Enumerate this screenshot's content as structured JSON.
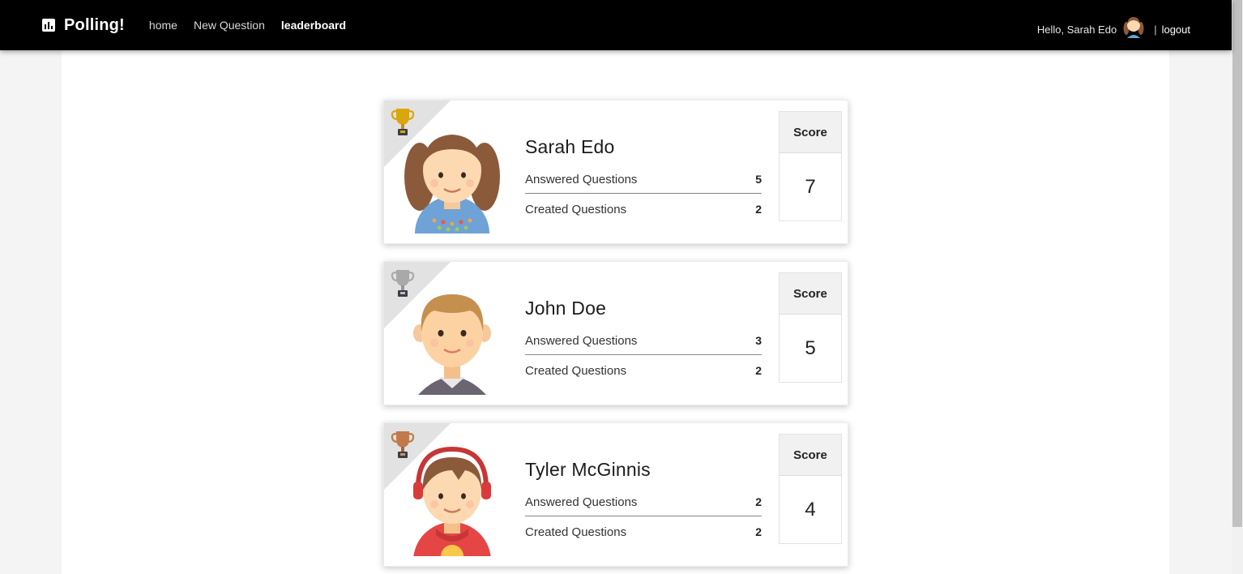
{
  "navbar": {
    "brand": "Polling!",
    "links": [
      {
        "label": "home",
        "active": false
      },
      {
        "label": "New Question",
        "active": false
      },
      {
        "label": "leaderboard",
        "active": true
      }
    ],
    "greeting": "Hello, Sarah Edo",
    "separator": "|",
    "logout_label": "logout"
  },
  "leaderboard": {
    "answered_label": "Answered Questions",
    "created_label": "Created Questions",
    "score_label": "Score",
    "entries": [
      {
        "name": "Sarah Edo",
        "answered": "5",
        "created": "2",
        "score": "7",
        "trophy": "gold-trophy-icon",
        "trophy_color": "#d9a70c"
      },
      {
        "name": "John Doe",
        "answered": "3",
        "created": "2",
        "score": "5",
        "trophy": "silver-trophy-icon",
        "trophy_color": "#a9a9a9"
      },
      {
        "name": "Tyler McGinnis",
        "answered": "2",
        "created": "2",
        "score": "4",
        "trophy": "bronze-trophy-icon",
        "trophy_color": "#c27a4c"
      }
    ]
  },
  "colors": {
    "navbar_bg": "#000000",
    "page_bg": "#f4f4f4",
    "score_header_bg": "#f1f1f1"
  }
}
